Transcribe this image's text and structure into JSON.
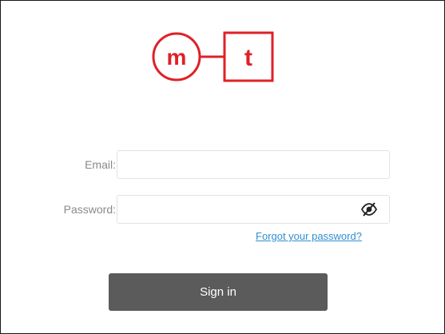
{
  "brand": {
    "logo_letters": [
      "m",
      "t"
    ],
    "logo_color": "#e02027"
  },
  "form": {
    "email_label": "Email:",
    "email_value": "",
    "email_placeholder": "",
    "password_label": "Password:",
    "password_value": "",
    "password_placeholder": "",
    "password_toggle_icon": "eye-slash-icon",
    "forgot_password_link": "Forgot your password?",
    "sign_in_label": "Sign in"
  },
  "colors": {
    "button_bg": "#5b5b5b",
    "link": "#2f8fd0",
    "label": "#8a8a8a"
  }
}
